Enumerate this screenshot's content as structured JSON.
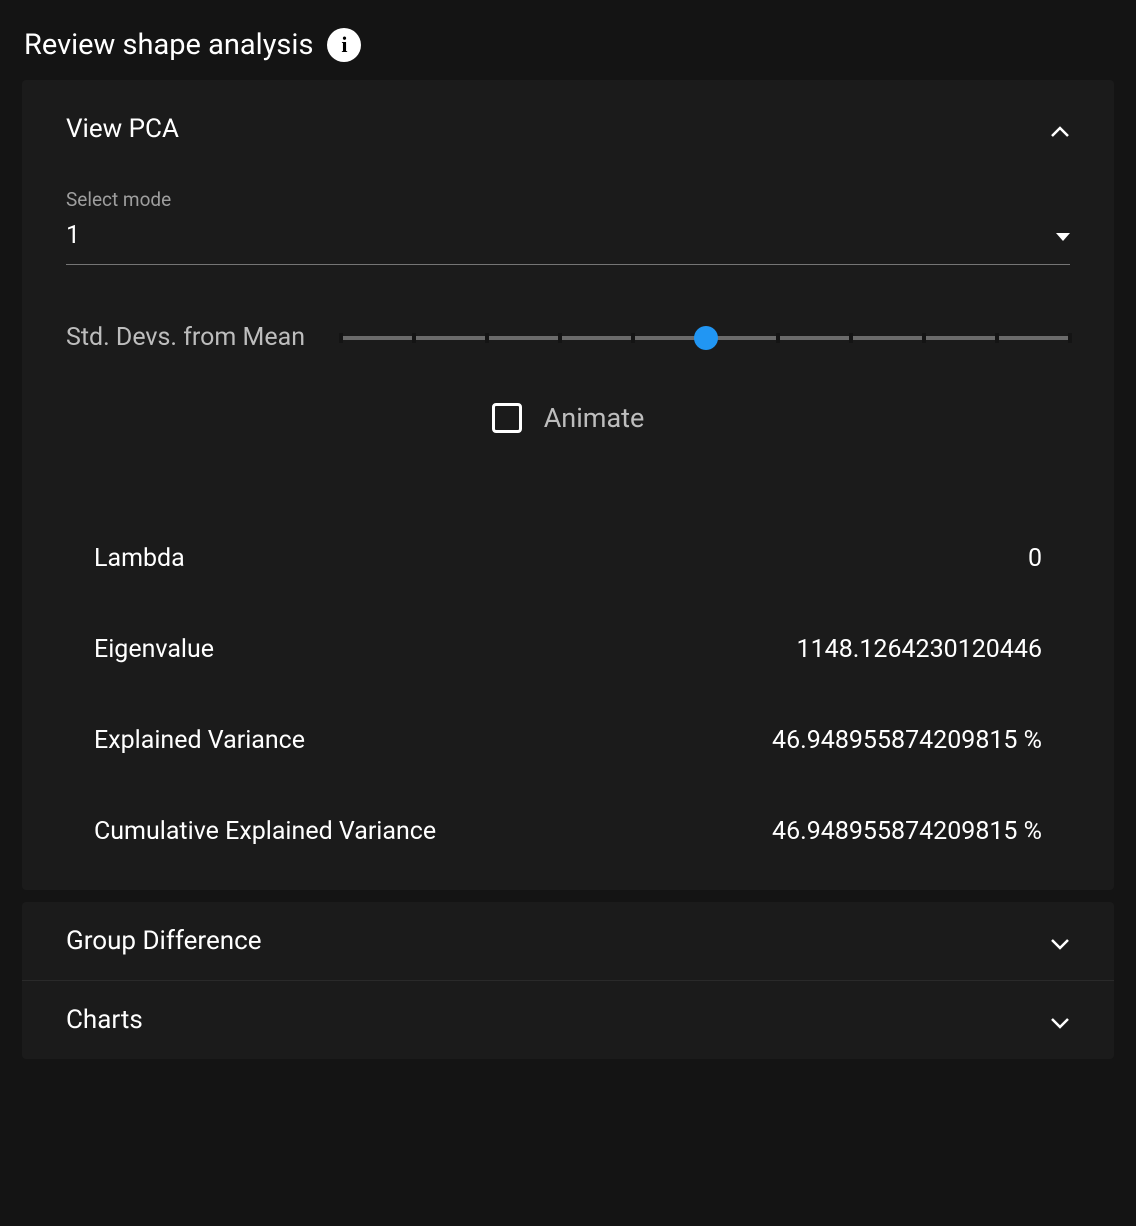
{
  "header": {
    "title": "Review shape analysis"
  },
  "pca": {
    "panel_title": "View PCA",
    "select_label": "Select mode",
    "select_value": "1",
    "slider_label": "Std. Devs. from Mean",
    "slider_position_pct": 50,
    "animate_label": "Animate",
    "animate_checked": false,
    "stats": [
      {
        "label": "Lambda",
        "value": "0"
      },
      {
        "label": "Eigenvalue",
        "value": "1148.1264230120446"
      },
      {
        "label": "Explained Variance",
        "value": "46.948955874209815 %"
      },
      {
        "label": "Cumulative Explained Variance",
        "value": "46.948955874209815 %"
      }
    ]
  },
  "group_diff": {
    "panel_title": "Group Difference"
  },
  "charts": {
    "panel_title": "Charts"
  }
}
